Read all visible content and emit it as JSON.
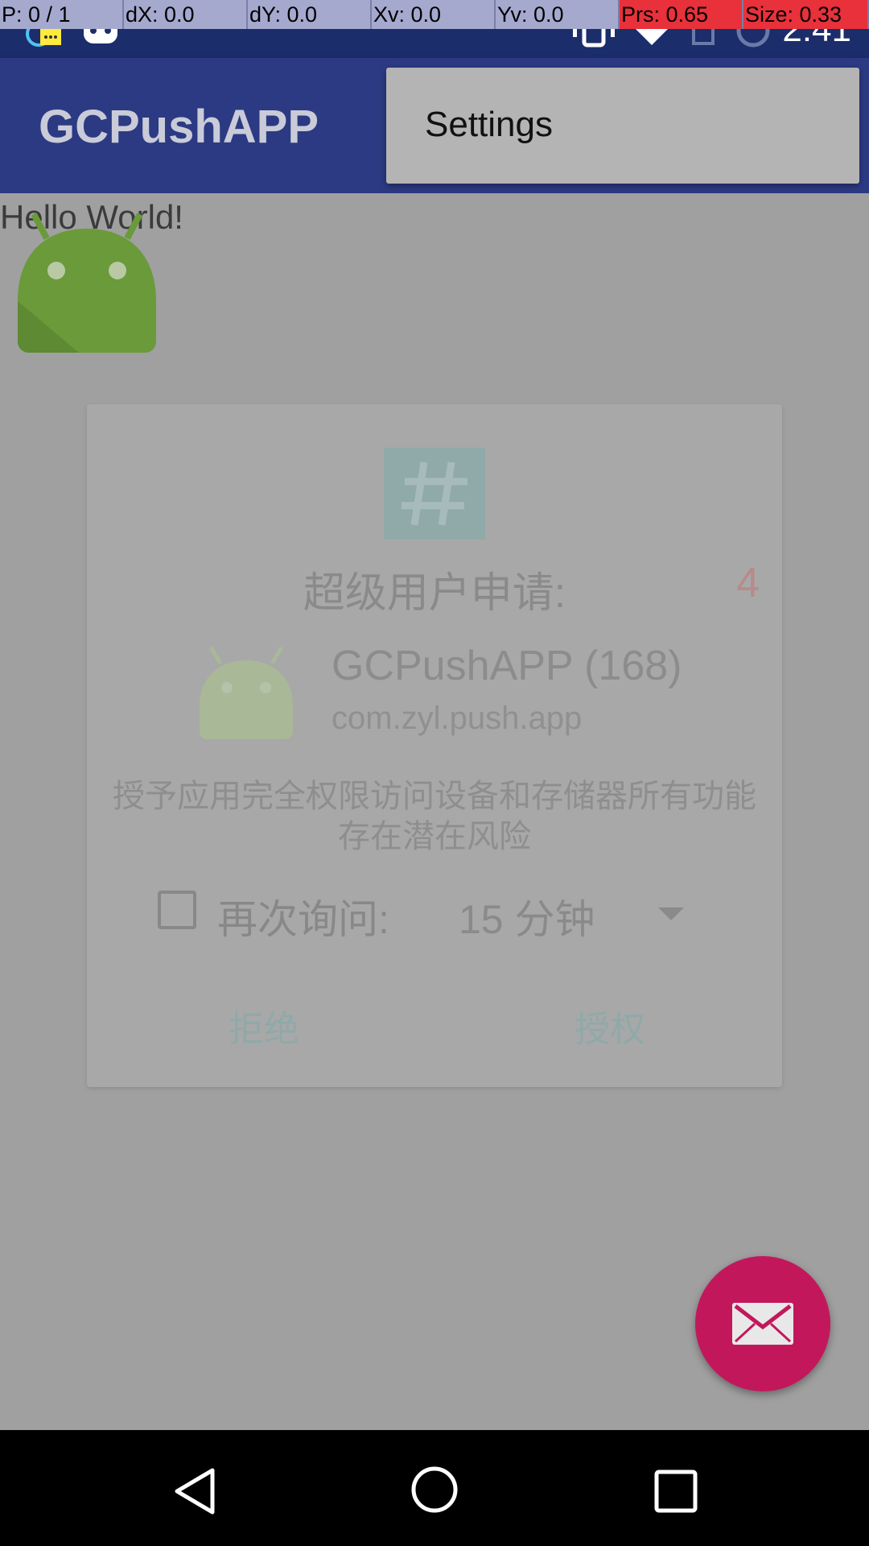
{
  "pointer_location": {
    "p": "P: 0 / 1",
    "dx": "dX: 0.0",
    "dy": "dY: 0.0",
    "xv": "Xv: 0.0",
    "yv": "Yv: 0.0",
    "prs": "Prs: 0.65",
    "size": "Size: 0.33"
  },
  "status_bar": {
    "time": "2:41"
  },
  "app_bar": {
    "title": "GCPushAPP"
  },
  "overflow_menu": {
    "items": [
      {
        "label": "Settings"
      }
    ]
  },
  "content": {
    "hello_text": "Hello World!"
  },
  "dialog": {
    "title": "超级用户申请:",
    "countdown": "4",
    "app_name": "GCPushAPP (168)",
    "package_name": "com.zyl.push.app",
    "warning": "授予应用完全权限访问设备和存储器所有功能存在潜在风险",
    "remember": {
      "label": "再次询问:",
      "value": "15 分钟",
      "checked": false
    },
    "deny_label": "拒绝",
    "grant_label": "授权"
  },
  "colors": {
    "app_bar": "#2c3a83",
    "status_bar": "#1b2d6b",
    "fab": "#c2185b",
    "scrim_background": "#a0a0a0",
    "android_green": "#6a9a3a"
  },
  "icons": {
    "status_left": [
      "sync-chat-icon",
      "android-robot-icon"
    ],
    "status_right": [
      "vibrate-icon",
      "wifi-icon",
      "no-sim-icon",
      "data-saver-icon"
    ],
    "fab": "envelope-icon",
    "dialog_header": "superuser-hash-icon",
    "nav": [
      "back-icon",
      "home-icon",
      "recents-icon"
    ]
  }
}
